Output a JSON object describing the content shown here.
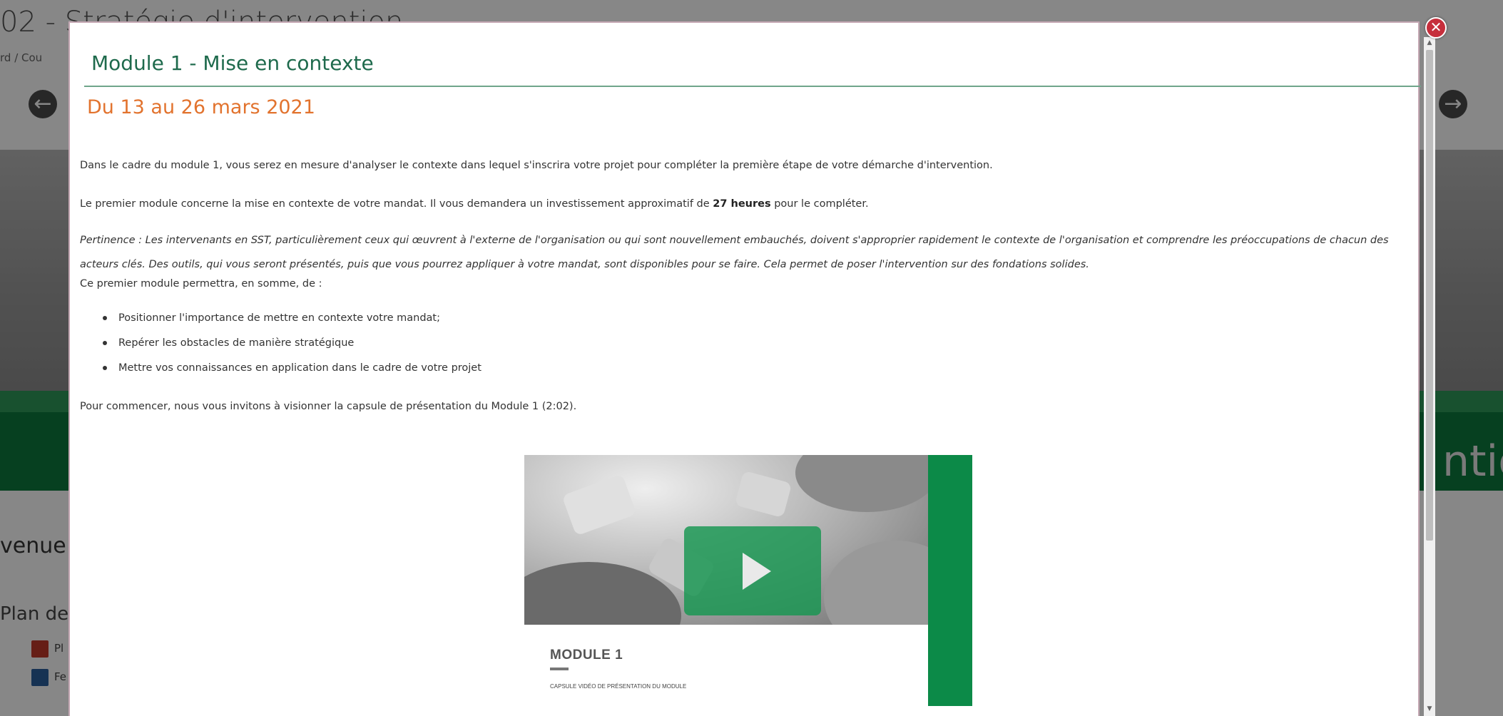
{
  "background_page": {
    "title_partial": "02 - Stratégie d'intervention",
    "breadcrumb_partial": "rd / Cou",
    "banner_text_partial": "ntio",
    "section_partial": "venue",
    "plan_partial": "Plan de",
    "item1_partial": "Pl",
    "item2_partial": "Fe"
  },
  "modal": {
    "title": "Module 1 - Mise en contexte",
    "date": "Du 13 au 26 mars 2021",
    "paragraph1": "Dans le cadre du module 1, vous serez en mesure d'analyser le contexte dans lequel s'inscrira votre projet pour compléter la première étape de votre démarche d'intervention.",
    "paragraph2_before": "Le premier module concerne la mise en contexte de votre mandat. Il vous demandera un investissement approximatif de ",
    "paragraph2_bold": "27 heures",
    "paragraph2_after": " pour le compléter.",
    "paragraph3": "Pertinence : Les intervenants en SST, particulièrement ceux qui œuvrent à l'externe de l'organisation ou qui sont nouvellement embauchés, doivent s'approprier rapidement le contexte de l'organisation et comprendre les préoccupations de chacun des acteurs clés. Des outils, qui vous seront présentés, puis que vous pourrez appliquer à votre mandat, sont disponibles pour se faire. Cela permet de poser l'intervention sur des fondations solides.",
    "paragraph4": "Ce premier module permettra, en somme, de :",
    "bullets": [
      "Positionner l'importance de mettre en contexte votre mandat;",
      "Repérer les obstacles de manière stratégique",
      "Mettre vos connaissances en application dans le cadre de votre projet"
    ],
    "paragraph5": "Pour commencer, nous vous invitons à visionner la capsule de présentation du Module 1 (2:02).",
    "video": {
      "title": "MODULE 1",
      "subtitle": "CAPSULE VIDÉO DE PRÉSENTATION DU MODULE"
    }
  },
  "icons": {
    "close": "close-icon",
    "prev": "arrow-left-icon",
    "next": "arrow-right-icon",
    "play": "play-icon"
  },
  "colors": {
    "header_green": "#1e6a4c",
    "date_orange": "#e2732e",
    "brand_green": "#0c8a48",
    "close_red": "#c62f3c"
  }
}
